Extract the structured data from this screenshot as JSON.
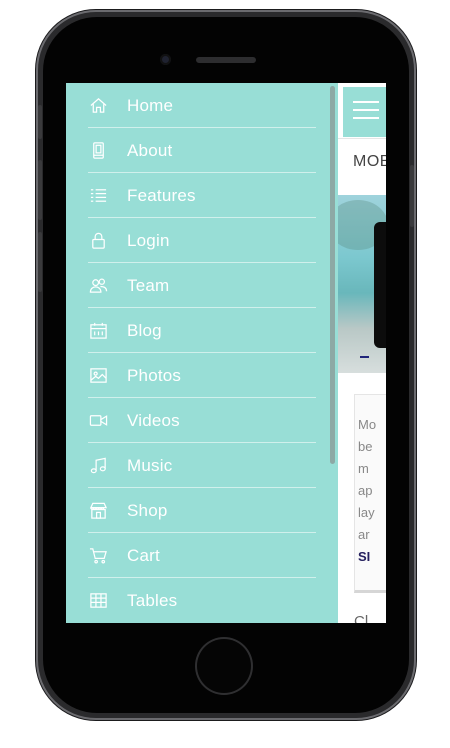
{
  "menu": {
    "items": [
      {
        "label": "Home",
        "icon": "home-icon"
      },
      {
        "label": "About",
        "icon": "phone-device-icon"
      },
      {
        "label": "Features",
        "icon": "list-icon"
      },
      {
        "label": "Login",
        "icon": "lock-icon"
      },
      {
        "label": "Team",
        "icon": "users-icon"
      },
      {
        "label": "Blog",
        "icon": "calendar-icon"
      },
      {
        "label": "Photos",
        "icon": "image-icon"
      },
      {
        "label": "Videos",
        "icon": "video-camera-icon"
      },
      {
        "label": "Music",
        "icon": "music-note-icon"
      },
      {
        "label": "Shop",
        "icon": "store-icon"
      },
      {
        "label": "Cart",
        "icon": "cart-icon"
      },
      {
        "label": "Tables",
        "icon": "table-icon"
      }
    ]
  },
  "content": {
    "header_text": "MOB",
    "card_lines": [
      "Mo",
      "be",
      "m",
      "ap",
      "lay",
      "ar"
    ],
    "card_link": "SI",
    "bottom_text": "Cl"
  },
  "colors": {
    "menu_background": "#98ded6",
    "accent_dark": "#25205e"
  }
}
